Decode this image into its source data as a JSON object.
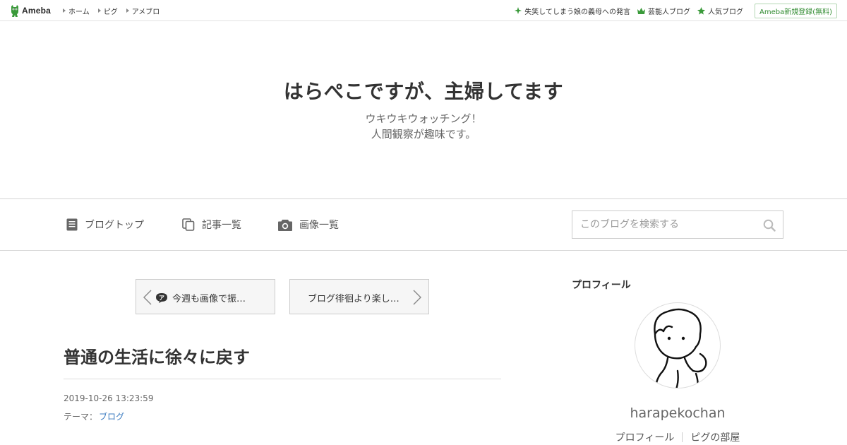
{
  "topbar": {
    "logo_text": "Ameba",
    "nav": [
      {
        "label": "ホーム"
      },
      {
        "label": "ピグ"
      },
      {
        "label": "アメブロ"
      }
    ],
    "links": [
      {
        "label": "失笑してしまう娘の義母への発言",
        "icon": "sparkle-icon"
      },
      {
        "label": "芸能人ブログ",
        "icon": "crown-icon"
      },
      {
        "label": "人気ブログ",
        "icon": "star-icon"
      }
    ],
    "register_label": "Ameba新規登録(無料)"
  },
  "header": {
    "title": "はらぺこですが、主婦してます",
    "description_line1": "ウキウキウォッチング！",
    "description_line2": "人間観察が趣味です。"
  },
  "nav": {
    "items": [
      {
        "label": "ブログトップ",
        "icon": "document-icon"
      },
      {
        "label": "記事一覧",
        "icon": "copy-icon"
      },
      {
        "label": "画像一覧",
        "icon": "camera-icon"
      }
    ],
    "search_placeholder": "このブログを検索する"
  },
  "pager": {
    "prev_label": "今週も画像で振…",
    "prev_badge": "ア",
    "next_label": "ブログ徘徊より楽し…"
  },
  "entry": {
    "title": "普通の生活に徐々に戻す",
    "date": "2019-10-26 13:23:59",
    "theme_label": "テーマ：",
    "theme_value": "ブログ"
  },
  "sidebar": {
    "heading": "プロフィール",
    "username": "harapekochan",
    "links": [
      {
        "label": "プロフィール"
      },
      {
        "label": "ピグの部屋"
      }
    ]
  },
  "colors": {
    "accent_green": "#2d8a2d",
    "link_blue": "#3b7bc0",
    "border": "#d5d5d5"
  }
}
